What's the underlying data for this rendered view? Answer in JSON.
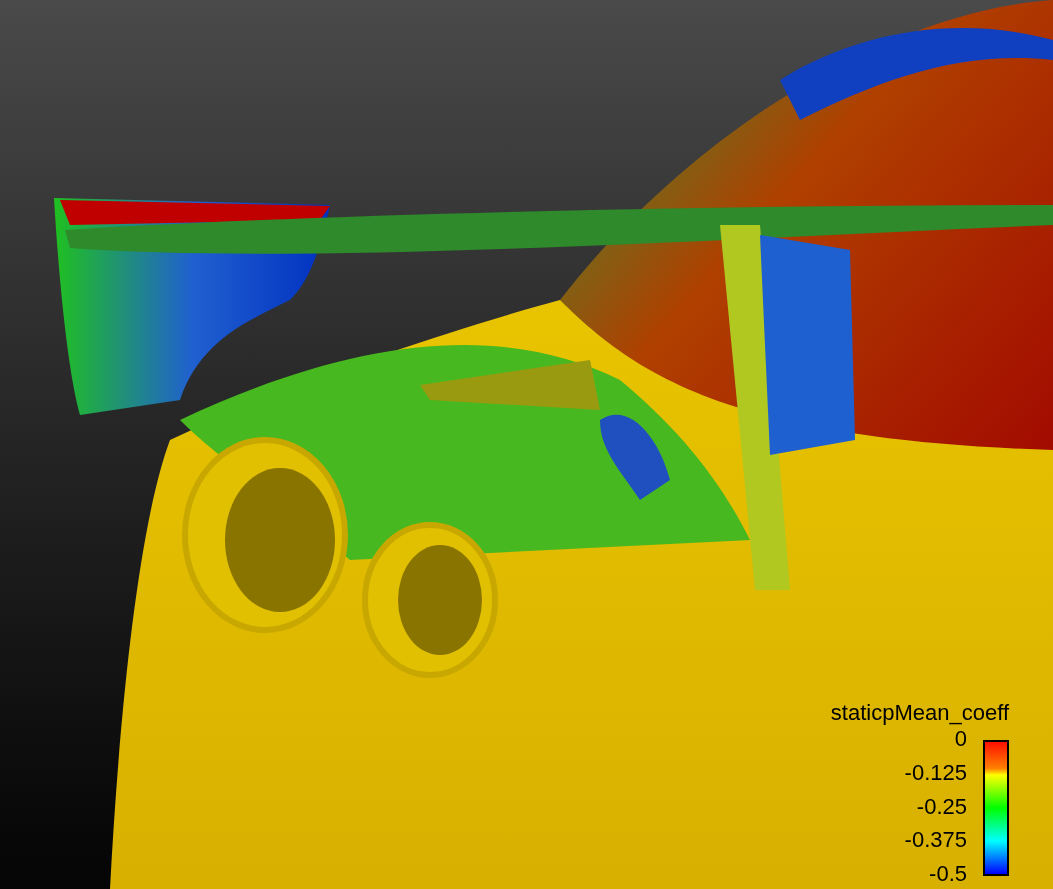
{
  "legend": {
    "title": "staticpMean_coeff",
    "labels": [
      "0",
      "-0.125",
      "-0.25",
      "-0.375",
      "-0.5"
    ]
  }
}
